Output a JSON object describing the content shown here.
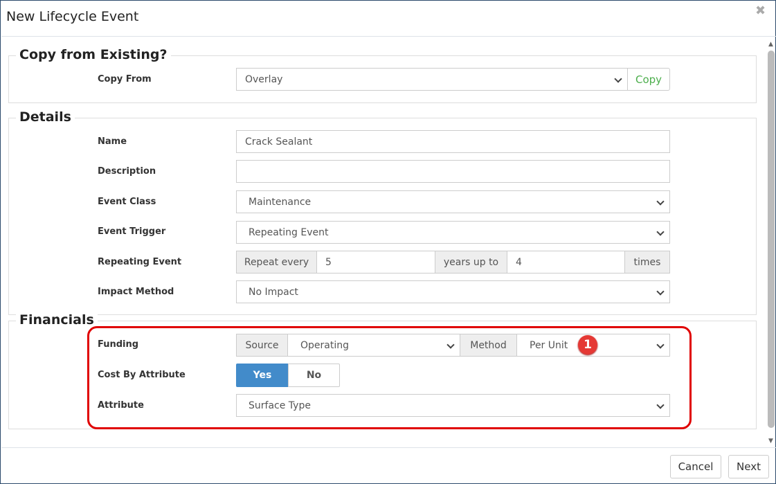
{
  "dialog": {
    "title": "New Lifecycle Event",
    "close_icon": "close-icon"
  },
  "copy_section": {
    "legend": "Copy from Existing?",
    "copy_from_label": "Copy From",
    "copy_from_value": "Overlay",
    "copy_button": "Copy"
  },
  "details": {
    "legend": "Details",
    "name_label": "Name",
    "name_value": "Crack Sealant",
    "description_label": "Description",
    "description_value": "",
    "event_class_label": "Event Class",
    "event_class_value": "Maintenance",
    "event_trigger_label": "Event Trigger",
    "event_trigger_value": "Repeating Event",
    "repeating_label": "Repeating Event",
    "repeat_every": "Repeat every",
    "repeat_value": "5",
    "years_up_to": "years up to",
    "times_value": "4",
    "times": "times",
    "impact_label": "Impact Method",
    "impact_value": "No Impact"
  },
  "financials": {
    "legend": "Financials",
    "funding_label": "Funding",
    "source_addon": "Source",
    "source_value": "Operating",
    "method_addon": "Method",
    "method_value": "Per Unit",
    "cost_by_attr_label": "Cost By Attribute",
    "yes": "Yes",
    "no": "No",
    "attribute_label": "Attribute",
    "attribute_value": "Surface Type"
  },
  "annotation": {
    "badge": "1"
  },
  "footer": {
    "cancel": "Cancel",
    "next": "Next"
  }
}
